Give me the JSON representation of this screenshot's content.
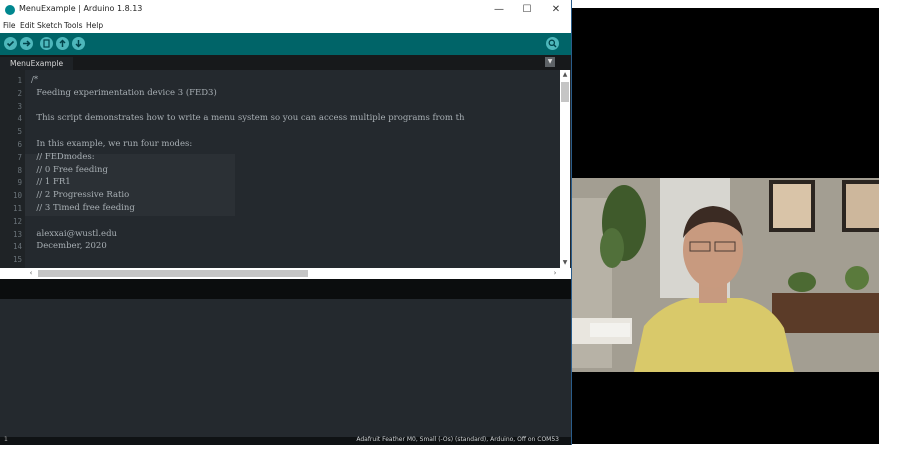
{
  "window": {
    "title": "MenuExample | Arduino 1.8.13",
    "minimize": "—",
    "maximize": "☐",
    "close": "✕"
  },
  "menubar": [
    "File",
    "Edit",
    "Sketch",
    "Tools",
    "Help"
  ],
  "toolbar": {
    "verify_icon": "check-icon",
    "upload_icon": "arrow-right-icon",
    "new_icon": "new-file-icon",
    "open_icon": "arrow-up-icon",
    "save_icon": "arrow-down-icon",
    "serial_icon": "magnifier-icon"
  },
  "tab": {
    "label": "MenuExample",
    "menu_glyph": "▼"
  },
  "code_lines": [
    {
      "num": "1",
      "text": "/*"
    },
    {
      "num": "2",
      "text": "  Feeding experimentation device 3 (FED3)"
    },
    {
      "num": "3",
      "text": ""
    },
    {
      "num": "4",
      "text": "  This script demonstrates how to write a menu system so you can access multiple programs from th"
    },
    {
      "num": "5",
      "text": ""
    },
    {
      "num": "6",
      "text": "  In this example, we run four modes:"
    },
    {
      "num": "7",
      "text": "  // FEDmodes:"
    },
    {
      "num": "8",
      "text": "  // 0 Free feeding"
    },
    {
      "num": "9",
      "text": "  // 1 FR1"
    },
    {
      "num": "10",
      "text": "  // 2 Progressive Ratio"
    },
    {
      "num": "11",
      "text": "  // 3 Timed free feeding"
    },
    {
      "num": "12",
      "text": ""
    },
    {
      "num": "13",
      "text": "  alexxai@wustl.edu"
    },
    {
      "num": "14",
      "text": "  December, 2020"
    },
    {
      "num": "15",
      "text": ""
    }
  ],
  "status": {
    "line_number": "1",
    "board": "Adafruit Feather M0, Small (-Os) (standard), Arduino, Off on COM53"
  },
  "colors": {
    "toolbar": "#006468",
    "editor_bg": "#24292e",
    "accent": "#4db7bb"
  }
}
